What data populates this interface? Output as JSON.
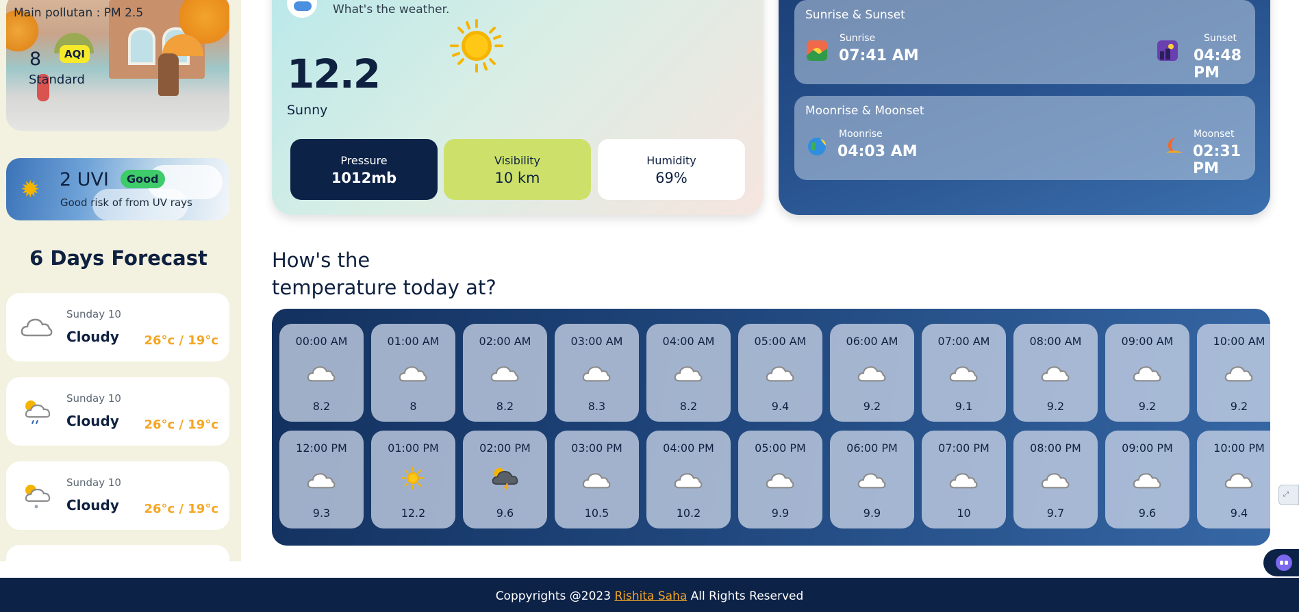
{
  "sidebar": {
    "aqi": {
      "pollutant_text": "Main pollutan : PM 2.5",
      "value": "8",
      "badge": "AQI",
      "standard": "Standard"
    },
    "uv": {
      "value": "2 UVI",
      "badge": "Good",
      "description": "Good risk of from UV rays"
    },
    "forecast": {
      "title": "6 Days Forecast",
      "days": [
        {
          "day": "Sunday 10",
          "condition": "Cloudy",
          "temp": "26°c / 19°c",
          "icon": "cloud-icon"
        },
        {
          "day": "Sunday 10",
          "condition": "Cloudy",
          "temp": "26°c / 19°c",
          "icon": "sun-cloud-rain-icon"
        },
        {
          "day": "Sunday 10",
          "condition": "Cloudy",
          "temp": "26°c / 19°c",
          "icon": "sun-cloud-snow-icon"
        }
      ]
    }
  },
  "current": {
    "subtitle": "What's the weather.",
    "temperature": "12.2",
    "condition": "Sunny",
    "icon": "sun-icon",
    "stats": {
      "pressure": {
        "label": "Pressure",
        "value": "1012mb"
      },
      "visibility": {
        "label": "Visibility",
        "value": "10 km"
      },
      "humidity": {
        "label": "Humidity",
        "value": "69%"
      }
    }
  },
  "astro": {
    "sun": {
      "title": "Sunrise & Sunset",
      "rise_label": "Sunrise",
      "rise_time": "07:41 AM",
      "set_label": "Sunset",
      "set_time": "04:48 PM"
    },
    "moon": {
      "title": "Moonrise & Moonset",
      "rise_label": "Moonrise",
      "rise_time": "04:03 AM",
      "set_label": "Moonset",
      "set_time": "02:31 PM"
    }
  },
  "hourly": {
    "title_line1": "How's the",
    "title_line2": "temperature today at?",
    "row1": [
      {
        "time": "00:00 AM",
        "temp": "8.2",
        "icon": "cloud-icon"
      },
      {
        "time": "01:00 AM",
        "temp": "8",
        "icon": "cloud-icon"
      },
      {
        "time": "02:00 AM",
        "temp": "8.2",
        "icon": "cloud-icon"
      },
      {
        "time": "03:00 AM",
        "temp": "8.3",
        "icon": "cloud-icon"
      },
      {
        "time": "04:00 AM",
        "temp": "8.2",
        "icon": "cloud-icon"
      },
      {
        "time": "05:00 AM",
        "temp": "9.4",
        "icon": "cloud-icon"
      },
      {
        "time": "06:00 AM",
        "temp": "9.2",
        "icon": "cloud-icon"
      },
      {
        "time": "07:00 AM",
        "temp": "9.1",
        "icon": "cloud-icon"
      },
      {
        "time": "08:00 AM",
        "temp": "9.2",
        "icon": "cloud-icon"
      },
      {
        "time": "09:00 AM",
        "temp": "9.2",
        "icon": "cloud-icon"
      },
      {
        "time": "10:00 AM",
        "temp": "9.2",
        "icon": "cloud-icon"
      }
    ],
    "row2": [
      {
        "time": "12:00 PM",
        "temp": "9.3",
        "icon": "cloud-icon"
      },
      {
        "time": "01:00 PM",
        "temp": "12.2",
        "icon": "sun-icon"
      },
      {
        "time": "02:00 PM",
        "temp": "9.6",
        "icon": "thunderstorm-icon"
      },
      {
        "time": "03:00 PM",
        "temp": "10.5",
        "icon": "cloud-icon"
      },
      {
        "time": "04:00 PM",
        "temp": "10.2",
        "icon": "cloud-icon"
      },
      {
        "time": "05:00 PM",
        "temp": "9.9",
        "icon": "cloud-icon"
      },
      {
        "time": "06:00 PM",
        "temp": "9.9",
        "icon": "cloud-icon"
      },
      {
        "time": "07:00 PM",
        "temp": "10",
        "icon": "cloud-icon"
      },
      {
        "time": "08:00 PM",
        "temp": "9.7",
        "icon": "cloud-icon"
      },
      {
        "time": "09:00 PM",
        "temp": "9.6",
        "icon": "cloud-icon"
      },
      {
        "time": "10:00 PM",
        "temp": "9.4",
        "icon": "cloud-icon"
      }
    ]
  },
  "footer": {
    "prefix": "Coppyrights @2023 ",
    "author": "Rishita Saha",
    "suffix": " All Rights Reserved"
  },
  "colors": {
    "navy": "#0c2247",
    "accent_orange": "#f5a623",
    "visibility_green": "#cde16a",
    "aqi_yellow": "#f7ea2a",
    "uv_good_green": "#3ecb6a"
  }
}
